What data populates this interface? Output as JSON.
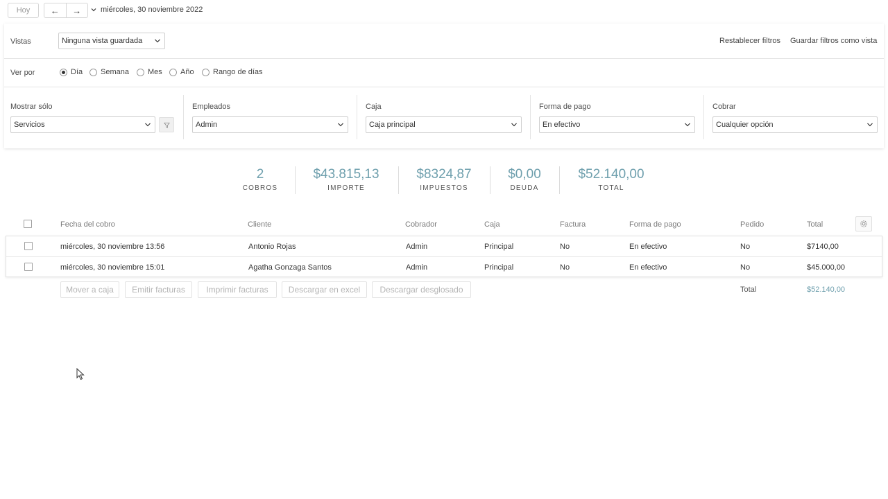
{
  "topbar": {
    "today_label": "Hoy",
    "date_label": "miércoles, 30 noviembre 2022"
  },
  "filters": {
    "views_label": "Vistas",
    "views_value": "Ninguna vista guardada",
    "reset_filters": "Restablecer filtros",
    "save_filters": "Guardar filtros como vista",
    "view_by_label": "Ver por",
    "view_by_options": [
      "Día",
      "Semana",
      "Mes",
      "Año",
      "Rango de días"
    ],
    "view_by_selected": "Día",
    "show_only_label": "Mostrar sólo",
    "show_only_value": "Servicios",
    "employees_label": "Empleados",
    "employees_value": "Admin",
    "cashbox_label": "Caja",
    "cashbox_value": "Caja principal",
    "payment_label": "Forma de pago",
    "payment_value": "En efectivo",
    "collect_label": "Cobrar",
    "collect_value": "Cualquier opción"
  },
  "stats": [
    {
      "value": "2",
      "caption": "COBROS"
    },
    {
      "value": "$43.815,13",
      "caption": "IMPORTE"
    },
    {
      "value": "$8324,87",
      "caption": "IMPUESTOS"
    },
    {
      "value": "$0,00",
      "caption": "DEUDA"
    },
    {
      "value": "$52.140,00",
      "caption": "TOTAL"
    }
  ],
  "table": {
    "columns": [
      "Fecha del cobro",
      "Cliente",
      "Cobrador",
      "Caja",
      "Factura",
      "Forma de pago",
      "Pedido",
      "Total"
    ],
    "rows": [
      [
        "miércoles, 30 noviembre 13:56",
        "Antonio Rojas",
        "Admin",
        "Principal",
        "No",
        "En efectivo",
        "No",
        "$7140,00"
      ],
      [
        "miércoles, 30 noviembre 15:01",
        "Agatha Gonzaga Santos",
        "Admin",
        "Principal",
        "No",
        "En efectivo",
        "No",
        "$45.000,00"
      ]
    ],
    "total_label": "Total",
    "total_value": "$52.140,00"
  },
  "actions": [
    "Mover a caja",
    "Emitir facturas",
    "Imprimir facturas",
    "Descargar en excel",
    "Descargar desglosado"
  ],
  "colors": {
    "accent": "#6e9fad"
  }
}
